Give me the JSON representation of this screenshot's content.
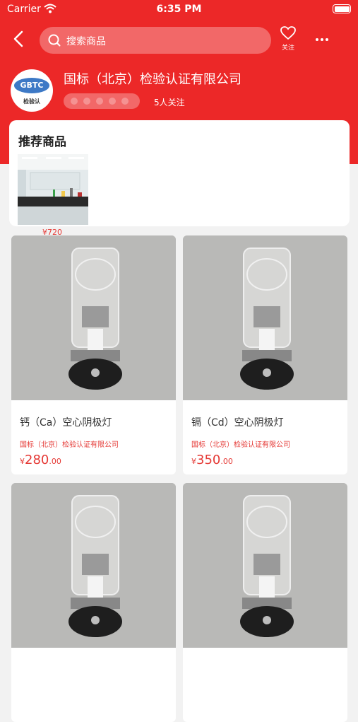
{
  "status_bar": {
    "carrier": "Carrier",
    "time": "6:35 PM"
  },
  "nav": {
    "search_placeholder": "搜索商品",
    "follow_label": "关注"
  },
  "shop": {
    "logo_text": "GBTC",
    "logo_subtext": "检验认",
    "name": "国标（北京）检验认证有限公司",
    "followers": "5人关注"
  },
  "recommended": {
    "title": "推荐商品",
    "items": [
      {
        "price": "¥720"
      }
    ]
  },
  "products": [
    {
      "title": "钙（Ca）空心阴极灯",
      "shop": "国标（北京）检验认证有限公司",
      "price_symbol": "¥",
      "price_int": "280",
      "price_dec": ".00"
    },
    {
      "title": "镉（Cd）空心阴极灯",
      "shop": "国标（北京）检验认证有限公司",
      "price_symbol": "¥",
      "price_int": "350",
      "price_dec": ".00"
    },
    {
      "title": "",
      "shop": "",
      "price_symbol": "",
      "price_int": "",
      "price_dec": ""
    },
    {
      "title": "",
      "shop": "",
      "price_symbol": "",
      "price_int": "",
      "price_dec": ""
    }
  ],
  "colors": {
    "brand_red": "#ec2828",
    "price_red": "#e53935"
  }
}
